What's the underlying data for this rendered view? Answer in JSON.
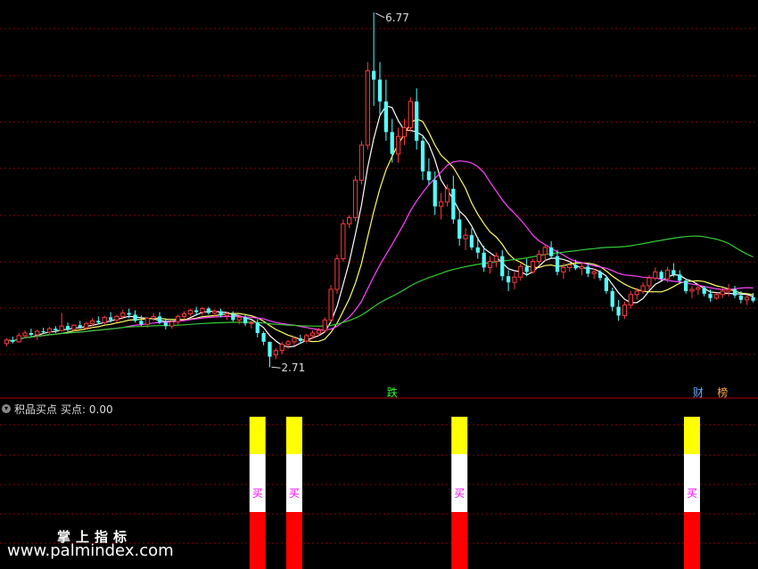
{
  "colors": {
    "up": "#ff3c3c",
    "down": "#54ffff",
    "ma5": "#ffffff",
    "ma10": "#ffff66",
    "ma20": "#ff44ff",
    "ma60": "#33cc33",
    "grid": "#8a0000",
    "signal_top": "#ffff00",
    "signal_mid": "#ffffff",
    "signal_bottom": "#ff0000",
    "buy_text": "#ff00ff"
  },
  "chart_data": [
    {
      "type": "candlestick",
      "title": "",
      "price_high_label": "6.77",
      "price_low_label": "2.71",
      "ylim": [
        2.55,
        6.85
      ],
      "candles": [
        [
          2.98,
          3.04,
          2.95,
          3.02
        ],
        [
          3.02,
          3.06,
          2.98,
          3.0
        ],
        [
          3.0,
          3.1,
          2.99,
          3.07
        ],
        [
          3.07,
          3.13,
          3.04,
          3.1
        ],
        [
          3.1,
          3.15,
          3.06,
          3.08
        ],
        [
          3.08,
          3.14,
          3.02,
          3.12
        ],
        [
          3.12,
          3.16,
          3.09,
          3.11
        ],
        [
          3.11,
          3.17,
          3.08,
          3.15
        ],
        [
          3.15,
          3.18,
          3.1,
          3.13
        ],
        [
          3.13,
          3.33,
          3.12,
          3.18
        ],
        [
          3.18,
          3.22,
          3.11,
          3.14
        ],
        [
          3.14,
          3.2,
          3.12,
          3.19
        ],
        [
          3.19,
          3.24,
          3.15,
          3.16
        ],
        [
          3.16,
          3.23,
          3.14,
          3.21
        ],
        [
          3.21,
          3.27,
          3.18,
          3.24
        ],
        [
          3.24,
          3.29,
          3.2,
          3.22
        ],
        [
          3.22,
          3.3,
          3.2,
          3.28
        ],
        [
          3.28,
          3.34,
          3.22,
          3.25
        ],
        [
          3.25,
          3.31,
          3.22,
          3.29
        ],
        [
          3.29,
          3.37,
          3.26,
          3.33
        ],
        [
          3.33,
          3.38,
          3.27,
          3.31
        ],
        [
          3.31,
          3.36,
          3.22,
          3.24
        ],
        [
          3.24,
          3.3,
          3.18,
          3.2
        ],
        [
          3.2,
          3.28,
          3.16,
          3.27
        ],
        [
          3.27,
          3.33,
          3.24,
          3.29
        ],
        [
          3.29,
          3.34,
          3.2,
          3.22
        ],
        [
          3.22,
          3.27,
          3.14,
          3.18
        ],
        [
          3.18,
          3.25,
          3.15,
          3.23
        ],
        [
          3.23,
          3.31,
          3.2,
          3.29
        ],
        [
          3.29,
          3.35,
          3.26,
          3.32
        ],
        [
          3.32,
          3.38,
          3.29,
          3.36
        ],
        [
          3.36,
          3.4,
          3.3,
          3.34
        ],
        [
          3.34,
          3.4,
          3.3,
          3.38
        ],
        [
          3.38,
          3.4,
          3.31,
          3.33
        ],
        [
          3.33,
          3.37,
          3.29,
          3.35
        ],
        [
          3.35,
          3.38,
          3.28,
          3.3
        ],
        [
          3.3,
          3.34,
          3.25,
          3.32
        ],
        [
          3.32,
          3.35,
          3.23,
          3.25
        ],
        [
          3.25,
          3.3,
          3.2,
          3.28
        ],
        [
          3.28,
          3.31,
          3.18,
          3.21
        ],
        [
          3.21,
          3.25,
          3.15,
          3.22
        ],
        [
          3.22,
          3.26,
          3.05,
          3.1
        ],
        [
          3.1,
          3.12,
          2.96,
          3.0
        ],
        [
          3.0,
          3.0,
          2.71,
          2.83
        ],
        [
          2.85,
          2.93,
          2.8,
          2.9
        ],
        [
          2.9,
          3.0,
          2.86,
          2.97
        ],
        [
          2.97,
          3.02,
          2.92,
          3.0
        ],
        [
          3.0,
          3.06,
          2.96,
          3.04
        ],
        [
          3.04,
          3.08,
          2.98,
          3.01
        ],
        [
          3.01,
          3.09,
          2.99,
          3.07
        ],
        [
          3.07,
          3.13,
          3.03,
          3.1
        ],
        [
          3.1,
          3.16,
          3.06,
          3.13
        ],
        [
          3.13,
          3.28,
          3.1,
          3.25
        ],
        [
          3.25,
          3.65,
          3.22,
          3.6
        ],
        [
          3.6,
          4.0,
          3.55,
          3.95
        ],
        [
          3.95,
          4.4,
          3.92,
          4.35
        ],
        [
          4.35,
          4.45,
          4.3,
          4.42
        ],
        [
          4.42,
          4.9,
          4.38,
          4.85
        ],
        [
          4.85,
          5.3,
          4.8,
          5.25
        ],
        [
          5.25,
          6.2,
          5.2,
          6.1
        ],
        [
          6.1,
          6.77,
          5.7,
          6.0
        ],
        [
          6.0,
          6.2,
          5.6,
          5.75
        ],
        [
          5.75,
          6.0,
          5.3,
          5.4
        ],
        [
          5.4,
          5.55,
          5.05,
          5.15
        ],
        [
          5.15,
          5.45,
          5.05,
          5.35
        ],
        [
          5.35,
          5.55,
          5.25,
          5.45
        ],
        [
          5.45,
          5.8,
          5.4,
          5.75
        ],
        [
          5.75,
          5.9,
          5.2,
          5.3
        ],
        [
          5.3,
          5.35,
          4.85,
          4.95
        ],
        [
          4.95,
          5.1,
          4.8,
          4.85
        ],
        [
          4.85,
          4.95,
          4.45,
          4.55
        ],
        [
          4.55,
          4.7,
          4.4,
          4.6
        ],
        [
          4.6,
          4.8,
          4.55,
          4.75
        ],
        [
          4.75,
          4.9,
          4.35,
          4.4
        ],
        [
          4.4,
          4.5,
          4.1,
          4.18
        ],
        [
          4.18,
          4.3,
          4.05,
          4.22
        ],
        [
          4.22,
          4.3,
          4.05,
          4.08
        ],
        [
          4.08,
          4.2,
          3.95,
          4.02
        ],
        [
          4.02,
          4.1,
          3.8,
          3.85
        ],
        [
          3.85,
          3.98,
          3.78,
          3.92
        ],
        [
          3.92,
          4.02,
          3.85,
          3.98
        ],
        [
          3.98,
          4.05,
          3.7,
          3.75
        ],
        [
          3.75,
          3.82,
          3.58,
          3.68
        ],
        [
          3.68,
          3.8,
          3.6,
          3.74
        ],
        [
          3.74,
          3.9,
          3.7,
          3.86
        ],
        [
          3.86,
          3.95,
          3.75,
          3.8
        ],
        [
          3.8,
          3.95,
          3.78,
          3.92
        ],
        [
          3.92,
          4.05,
          3.88,
          4.0
        ],
        [
          4.0,
          4.12,
          3.92,
          4.08
        ],
        [
          4.08,
          4.15,
          3.95,
          3.98
        ],
        [
          3.98,
          4.05,
          3.76,
          3.8
        ],
        [
          3.8,
          3.9,
          3.72,
          3.85
        ],
        [
          3.85,
          3.92,
          3.8,
          3.88
        ],
        [
          3.88,
          3.94,
          3.82,
          3.84
        ],
        [
          3.84,
          3.9,
          3.76,
          3.86
        ],
        [
          3.86,
          3.9,
          3.74,
          3.78
        ],
        [
          3.78,
          3.84,
          3.72,
          3.8
        ],
        [
          3.8,
          3.82,
          3.7,
          3.73
        ],
        [
          3.73,
          3.76,
          3.55,
          3.58
        ],
        [
          3.58,
          3.62,
          3.35,
          3.4
        ],
        [
          3.4,
          3.48,
          3.24,
          3.3
        ],
        [
          3.3,
          3.46,
          3.26,
          3.42
        ],
        [
          3.42,
          3.58,
          3.38,
          3.54
        ],
        [
          3.54,
          3.62,
          3.48,
          3.58
        ],
        [
          3.58,
          3.68,
          3.55,
          3.64
        ],
        [
          3.64,
          3.76,
          3.6,
          3.73
        ],
        [
          3.73,
          3.85,
          3.7,
          3.8
        ],
        [
          3.8,
          3.82,
          3.7,
          3.72
        ],
        [
          3.72,
          3.86,
          3.68,
          3.82
        ],
        [
          3.82,
          3.9,
          3.74,
          3.77
        ],
        [
          3.77,
          3.82,
          3.66,
          3.7
        ],
        [
          3.7,
          3.72,
          3.55,
          3.58
        ],
        [
          3.58,
          3.64,
          3.5,
          3.6
        ],
        [
          3.6,
          3.66,
          3.54,
          3.62
        ],
        [
          3.62,
          3.64,
          3.52,
          3.55
        ],
        [
          3.55,
          3.6,
          3.46,
          3.5
        ],
        [
          3.5,
          3.56,
          3.48,
          3.54
        ],
        [
          3.54,
          3.62,
          3.5,
          3.58
        ],
        [
          3.58,
          3.66,
          3.52,
          3.6
        ],
        [
          3.6,
          3.64,
          3.5,
          3.53
        ],
        [
          3.53,
          3.58,
          3.44,
          3.48
        ],
        [
          3.48,
          3.54,
          3.42,
          3.51
        ],
        [
          3.51,
          3.56,
          3.45,
          3.47
        ]
      ],
      "ma_series": [
        {
          "key": "ma5",
          "window": 5
        },
        {
          "key": "ma10",
          "window": 10
        },
        {
          "key": "ma20",
          "window": 20
        },
        {
          "key": "ma60",
          "window": 60
        }
      ],
      "event_tags": [
        {
          "text": "跌",
          "index": 63,
          "color": "#33ff33"
        },
        {
          "text": "财",
          "index": 113,
          "color": "#66aaff"
        },
        {
          "text": "榜",
          "index": 117,
          "color": "#ffaa44"
        }
      ]
    },
    {
      "type": "bar",
      "title": "积品买点",
      "value_label": "买点: 0.00",
      "signals": [
        {
          "index": 41,
          "text": "买"
        },
        {
          "index": 47,
          "text": "买"
        },
        {
          "index": 74,
          "text": "买"
        },
        {
          "index": 112,
          "text": "买"
        }
      ]
    }
  ],
  "watermark": {
    "cn": "掌上指标",
    "url": "www.palmindex.com"
  }
}
